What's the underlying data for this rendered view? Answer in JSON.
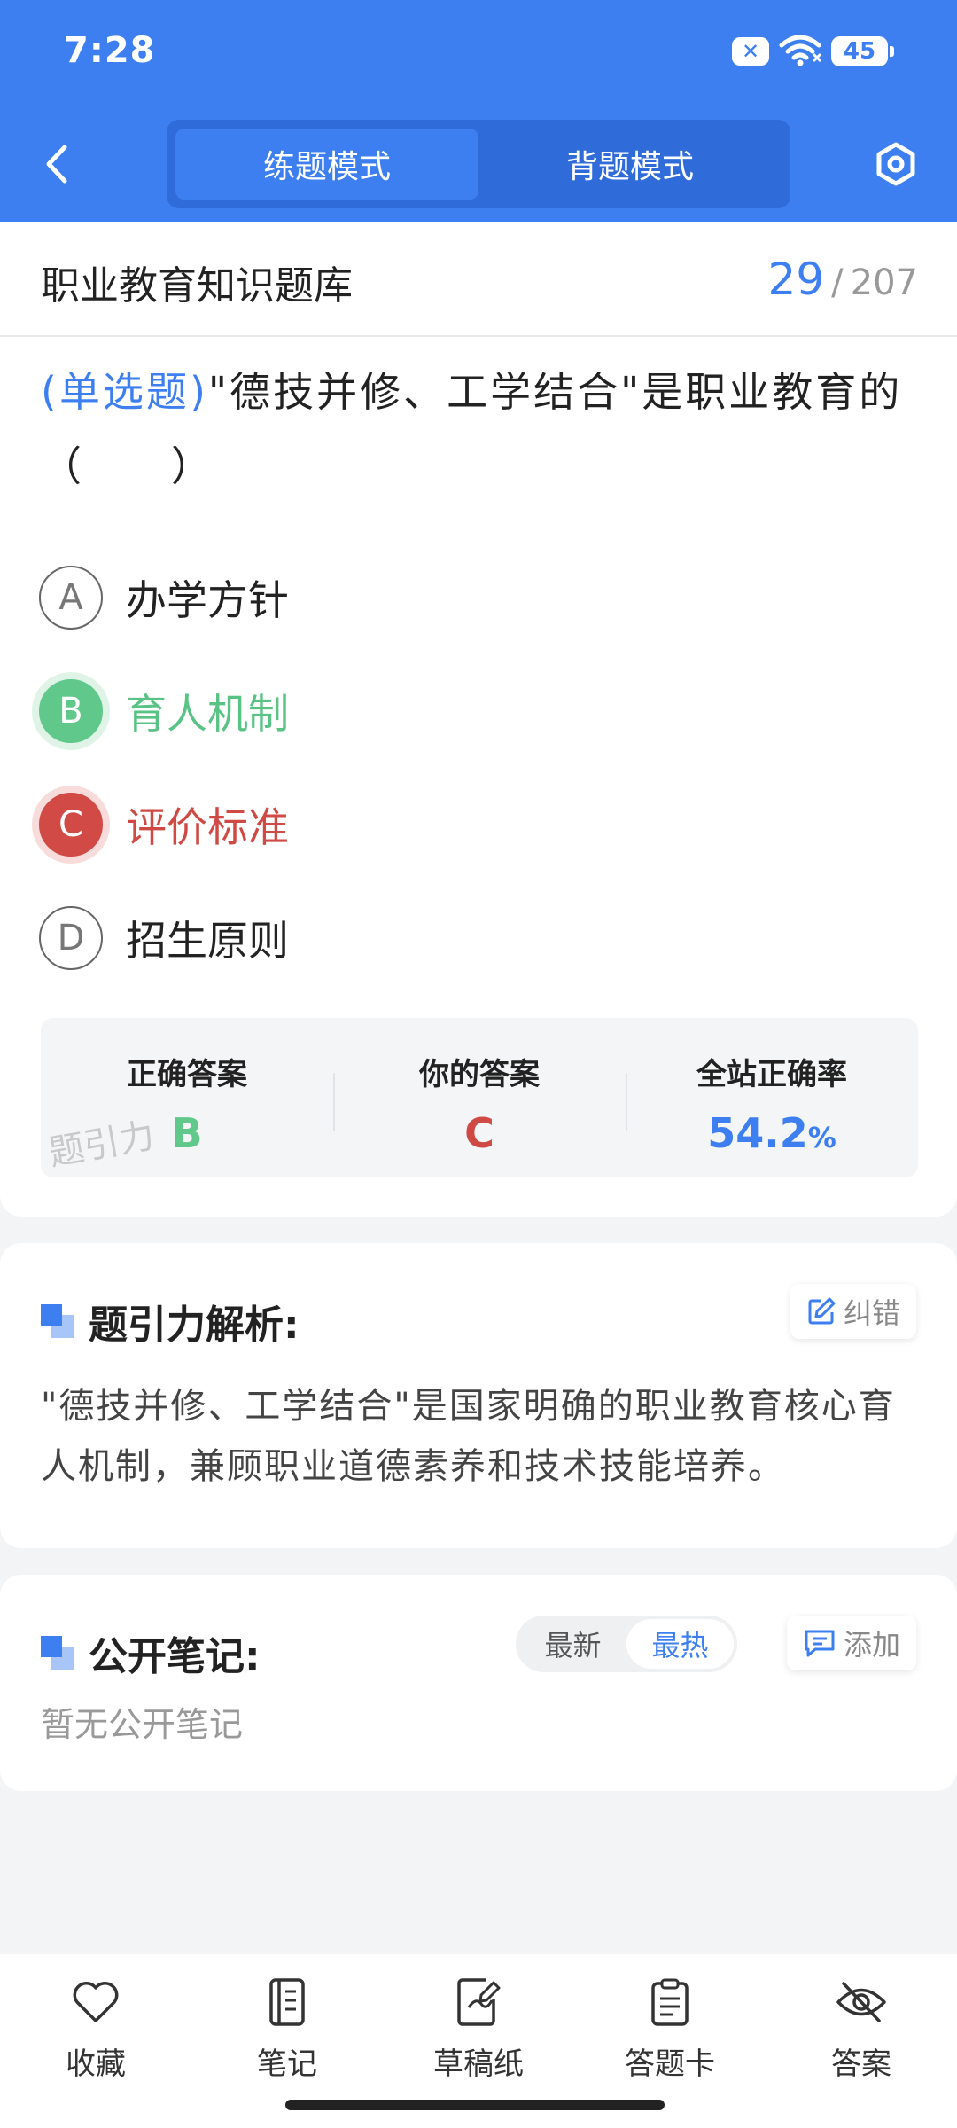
{
  "status_bar": {
    "time": "7:28",
    "battery": "45",
    "sim_glyph": "✕",
    "icons": [
      "sim-blocked-icon",
      "wifi-icon",
      "battery-icon"
    ]
  },
  "header": {
    "tabs": [
      {
        "label": "练题模式",
        "active": true
      },
      {
        "label": "背题模式",
        "active": false
      }
    ],
    "icons": [
      "back-arrow-icon",
      "settings-hexagon-icon"
    ]
  },
  "bank": {
    "title": "职业教育知识题库",
    "current": "29",
    "separator": "/",
    "total": "207"
  },
  "question": {
    "type": "(单选题)",
    "text": "\"德技并修、工学结合\"是职业教育的（　　）",
    "options": [
      {
        "letter": "A",
        "text": "办学方针",
        "state": "normal"
      },
      {
        "letter": "B",
        "text": "育人机制",
        "state": "correct"
      },
      {
        "letter": "C",
        "text": "评价标准",
        "state": "wrong"
      },
      {
        "letter": "D",
        "text": "招生原则",
        "state": "normal"
      }
    ]
  },
  "answer_panel": {
    "correct_label": "正确答案",
    "correct_value": "B",
    "mine_label": "你的答案",
    "mine_value": "C",
    "rate_label": "全站正确率",
    "rate_value": "54.2",
    "rate_unit": "%",
    "watermark": "题引力"
  },
  "analysis": {
    "title": "题引力解析:",
    "report_label": "纠错",
    "text": "\"德技并修、工学结合\"是国家明确的职业教育核心育人机制，兼顾职业道德素养和技术技能培养。"
  },
  "notes": {
    "title": "公开笔记:",
    "sort_options": [
      {
        "label": "最新",
        "active": false
      },
      {
        "label": "最热",
        "active": true
      }
    ],
    "add_label": "添加",
    "empty_text": "暂无公开笔记"
  },
  "bottom_nav": [
    {
      "label": "收藏",
      "icon": "heart-icon"
    },
    {
      "label": "笔记",
      "icon": "notebook-icon"
    },
    {
      "label": "草稿纸",
      "icon": "scratch-paper-icon"
    },
    {
      "label": "答题卡",
      "icon": "answer-card-icon"
    },
    {
      "label": "答案",
      "icon": "eye-off-icon"
    }
  ],
  "colors": {
    "primary": "#3d7ff0",
    "correct": "#5fc88a",
    "wrong": "#cf4a45",
    "background": "#f3f4f6"
  }
}
